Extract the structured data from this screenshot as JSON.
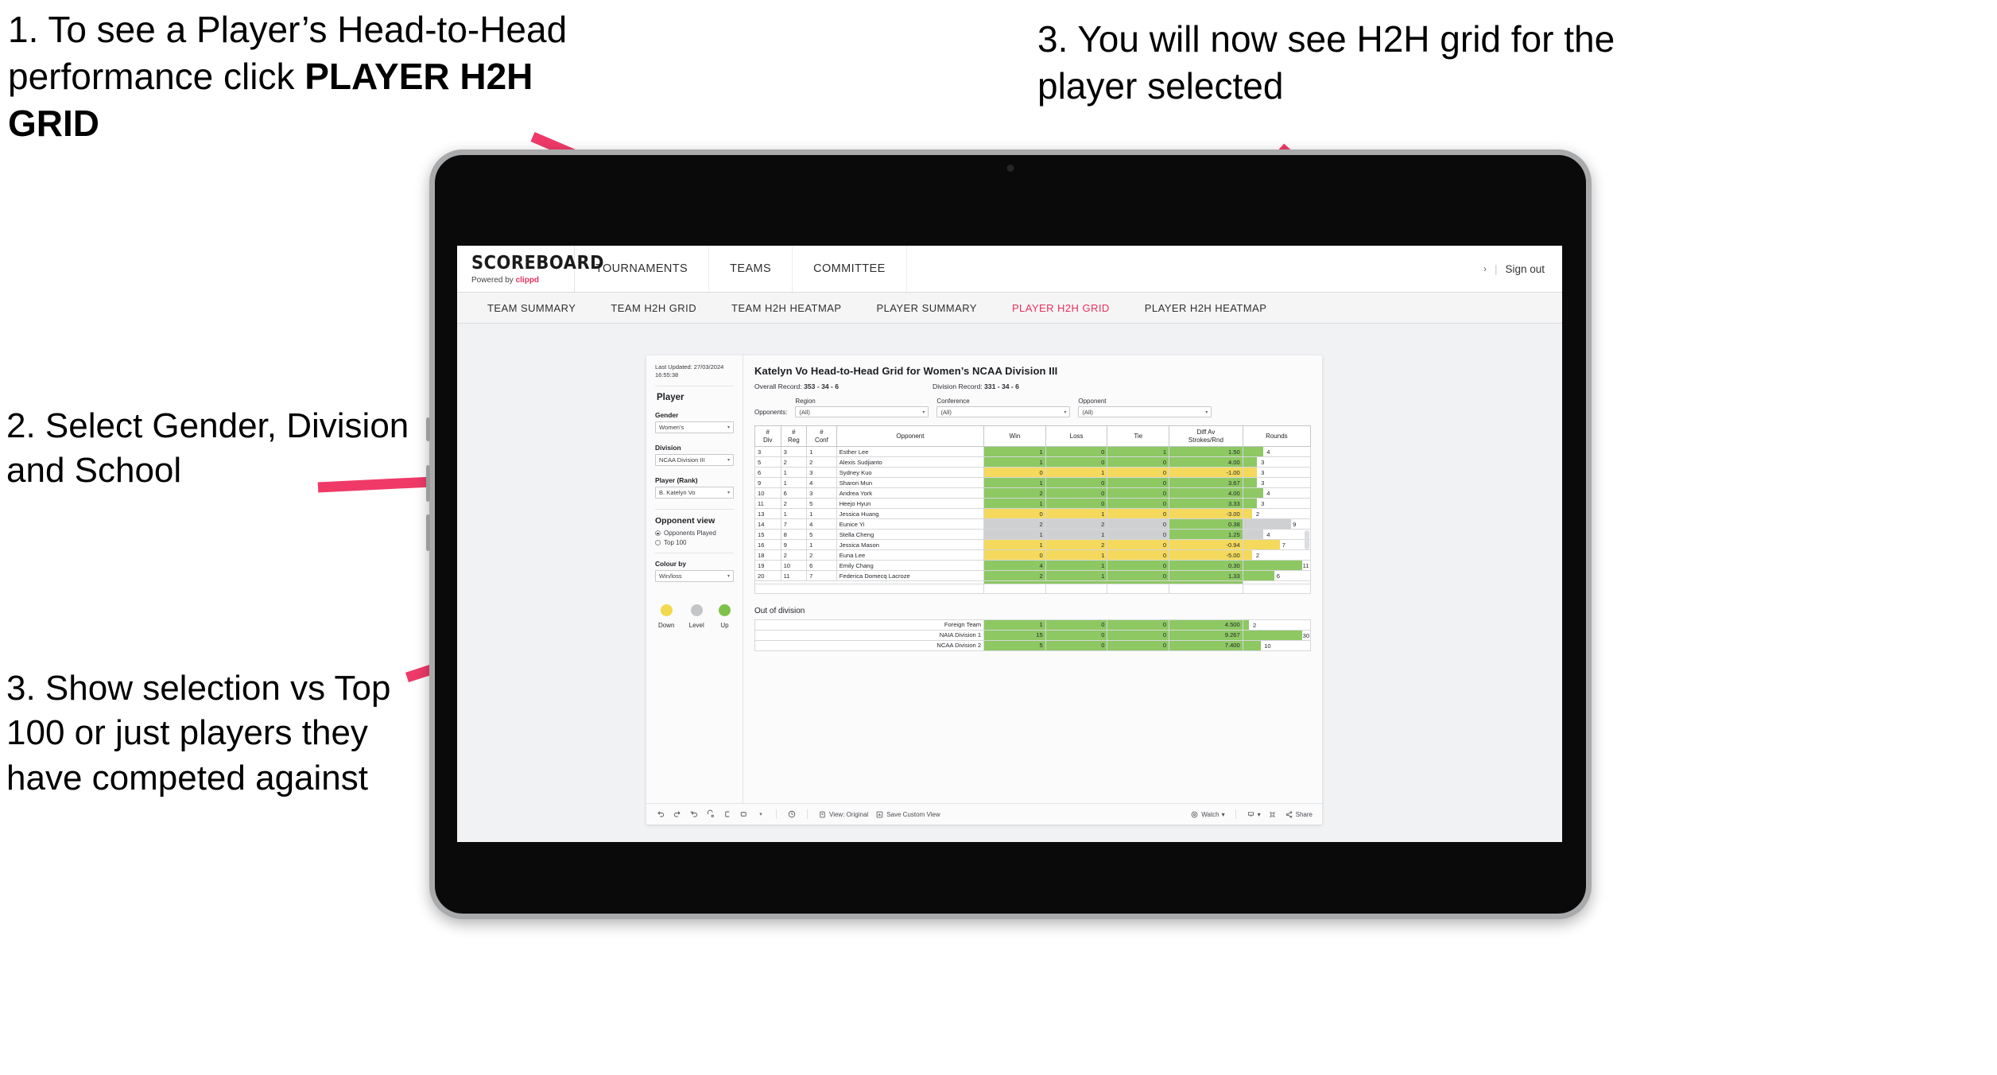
{
  "annotations": {
    "step1": "1. To see a Player’s Head-to-Head performance click ",
    "step1_bold": "PLAYER H2H GRID",
    "step3_top": "3. You will now see H2H grid for the player selected",
    "step2": "2. Select Gender, Division and School",
    "step3_left": "3. Show selection vs Top 100 or just players they have competed against",
    "arrow_color": "#ef3a68"
  },
  "app": {
    "brand": {
      "name": "SCOREBOARD",
      "powered_prefix": "Powered by ",
      "powered_brand": "clippd"
    },
    "topnav": [
      "TOURNAMENTS",
      "TEAMS",
      "COMMITTEE"
    ],
    "account": {
      "chevron": "›",
      "divider": "|",
      "sign_out": "Sign out"
    },
    "tabs": [
      {
        "label": "TEAM SUMMARY",
        "active": false
      },
      {
        "label": "TEAM H2H GRID",
        "active": false
      },
      {
        "label": "TEAM H2H HEATMAP",
        "active": false
      },
      {
        "label": "PLAYER SUMMARY",
        "active": false
      },
      {
        "label": "PLAYER H2H GRID",
        "active": true
      },
      {
        "label": "PLAYER H2H HEATMAP",
        "active": false
      }
    ]
  },
  "sidebar": {
    "last_updated": "Last Updated: 27/03/2024 16:55:38",
    "section_player": "Player",
    "fields": [
      {
        "label": "Gender",
        "value": "Women's"
      },
      {
        "label": "Division",
        "value": "NCAA Division III"
      },
      {
        "label": "Player (Rank)",
        "value": "B. Katelyn Vo"
      }
    ],
    "opponent_view": {
      "title": "Opponent view",
      "options": [
        {
          "label": "Opponents Played",
          "selected": true
        },
        {
          "label": "Top 100",
          "selected": false
        }
      ]
    },
    "colour_by": {
      "label": "Colour by",
      "value": "Win/loss"
    },
    "legend": [
      {
        "caption": "Down",
        "color": "#f2d94e"
      },
      {
        "caption": "Level",
        "color": "#c4c5c7"
      },
      {
        "caption": "Up",
        "color": "#7ec24a"
      }
    ]
  },
  "report": {
    "title": "Katelyn Vo Head-to-Head Grid for Women’s NCAA Division III",
    "overall_record_label": "Overall Record:",
    "overall_record_value": "353 - 34 - 6",
    "division_record_label": "Division Record:",
    "division_record_value": "331 - 34 - 6",
    "opponents_label": "Opponents:",
    "filters": [
      {
        "label": "Region",
        "value": "(All)"
      },
      {
        "label": "Conference",
        "value": "(All)"
      },
      {
        "label": "Opponent",
        "value": "(All)"
      }
    ],
    "columns": [
      "# Div",
      "# Reg",
      "# Conf",
      "Opponent",
      "Win",
      "Loss",
      "Tie",
      "Diff Av Strokes/Rnd",
      "Rounds"
    ],
    "rows": [
      {
        "div": "3",
        "reg": "3",
        "conf": "1",
        "opponent": "Esther Lee",
        "win": "1",
        "loss": "0",
        "tie": "1",
        "diff": "1.50",
        "rounds": "4",
        "color": "#8dc863",
        "bar_pct": 30
      },
      {
        "div": "5",
        "reg": "2",
        "conf": "2",
        "opponent": "Alexis Sudjianto",
        "win": "1",
        "loss": "0",
        "tie": "0",
        "diff": "4.00",
        "rounds": "3",
        "color": "#8dc863",
        "bar_pct": 21
      },
      {
        "div": "6",
        "reg": "1",
        "conf": "3",
        "opponent": "Sydney Kuo",
        "win": "0",
        "loss": "1",
        "tie": "0",
        "diff": "-1.00",
        "rounds": "3",
        "color": "#f4d95c",
        "bar_pct": 21
      },
      {
        "div": "9",
        "reg": "1",
        "conf": "4",
        "opponent": "Sharon Mun",
        "win": "1",
        "loss": "0",
        "tie": "0",
        "diff": "3.67",
        "rounds": "3",
        "color": "#8dc863",
        "bar_pct": 21
      },
      {
        "div": "10",
        "reg": "6",
        "conf": "3",
        "opponent": "Andrea York",
        "win": "2",
        "loss": "0",
        "tie": "0",
        "diff": "4.00",
        "rounds": "4",
        "color": "#8dc863",
        "bar_pct": 30
      },
      {
        "div": "11",
        "reg": "2",
        "conf": "5",
        "opponent": "Heejo Hyun",
        "win": "1",
        "loss": "0",
        "tie": "0",
        "diff": "3.33",
        "rounds": "3",
        "color": "#8dc863",
        "bar_pct": 21
      },
      {
        "div": "13",
        "reg": "1",
        "conf": "1",
        "opponent": "Jessica Huang",
        "win": "0",
        "loss": "1",
        "tie": "0",
        "diff": "-3.00",
        "rounds": "2",
        "color": "#f4d95c",
        "bar_pct": 13
      },
      {
        "div": "14",
        "reg": "7",
        "conf": "4",
        "opponent": "Eunice Yi",
        "win": "2",
        "loss": "2",
        "tie": "0",
        "diff": "0.38",
        "rounds": "9",
        "color": "#cfd0d2",
        "bar_pct": 72,
        "diff_color": "#8dc863"
      },
      {
        "div": "15",
        "reg": "8",
        "conf": "5",
        "opponent": "Stella Cheng",
        "win": "1",
        "loss": "1",
        "tie": "0",
        "diff": "1.25",
        "rounds": "4",
        "color": "#cfd0d2",
        "bar_pct": 30,
        "diff_color": "#8dc863"
      },
      {
        "div": "16",
        "reg": "9",
        "conf": "1",
        "opponent": "Jessica Mason",
        "win": "1",
        "loss": "2",
        "tie": "0",
        "diff": "-0.94",
        "rounds": "7",
        "color": "#f4d95c",
        "bar_pct": 55
      },
      {
        "div": "18",
        "reg": "2",
        "conf": "2",
        "opponent": "Euna Lee",
        "win": "0",
        "loss": "1",
        "tie": "0",
        "diff": "-5.00",
        "rounds": "2",
        "color": "#f4d95c",
        "bar_pct": 13
      },
      {
        "div": "19",
        "reg": "10",
        "conf": "6",
        "opponent": "Emily Chang",
        "win": "4",
        "loss": "1",
        "tie": "0",
        "diff": "0.30",
        "rounds": "11",
        "color": "#8dc863",
        "bar_pct": 88
      },
      {
        "div": "20",
        "reg": "11",
        "conf": "7",
        "opponent": "Federica Domecq Lacroze",
        "win": "2",
        "loss": "1",
        "tie": "0",
        "diff": "1.33",
        "rounds": "6",
        "color": "#8dc863",
        "bar_pct": 46
      }
    ],
    "out_of_division_title": "Out of division",
    "out_of_division_rows": [
      {
        "name": "Foreign Team",
        "win": "1",
        "loss": "0",
        "tie": "0",
        "diff": "4.500",
        "rounds": "2",
        "color": "#8dc863",
        "bar_pct": 8
      },
      {
        "name": "NAIA Division 1",
        "win": "15",
        "loss": "0",
        "tie": "0",
        "diff": "9.267",
        "rounds": "30",
        "color": "#8dc863",
        "bar_pct": 88
      },
      {
        "name": "NCAA Division 2",
        "win": "5",
        "loss": "0",
        "tie": "0",
        "diff": "7.400",
        "rounds": "10",
        "color": "#8dc863",
        "bar_pct": 26
      }
    ]
  },
  "toolbar": {
    "icons": [
      "undo-icon",
      "redo-icon",
      "revert-icon",
      "refresh-icon",
      "pause-icon",
      "highlight-icon",
      "chevron-down-icon",
      "presentation-icon"
    ],
    "view_label": "View: Original",
    "save_label": "Save Custom View",
    "watch_label": "Watch",
    "watch_caret": "▾",
    "download_caret": "▾",
    "share_label": "Share"
  }
}
